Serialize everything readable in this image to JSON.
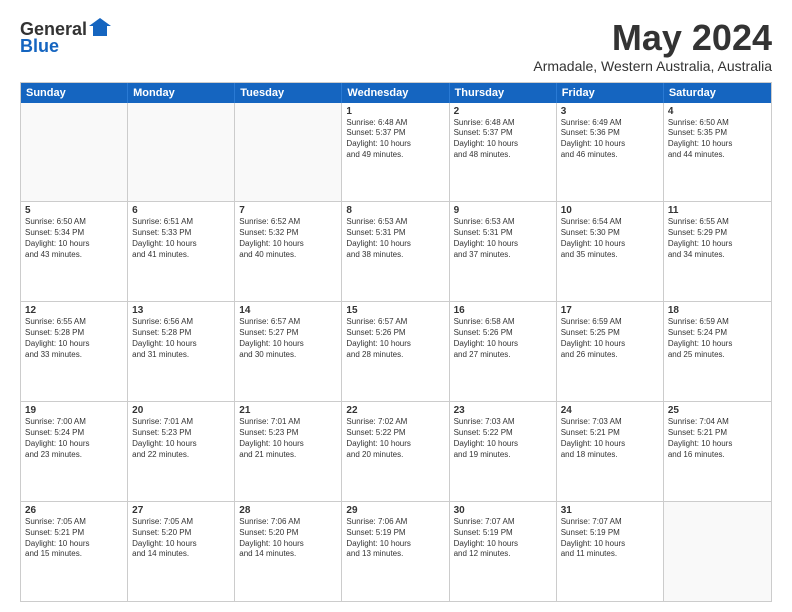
{
  "logo": {
    "general": "General",
    "blue": "Blue"
  },
  "title": "May 2024",
  "location": "Armadale, Western Australia, Australia",
  "headers": [
    "Sunday",
    "Monday",
    "Tuesday",
    "Wednesday",
    "Thursday",
    "Friday",
    "Saturday"
  ],
  "rows": [
    [
      {
        "day": "",
        "empty": true
      },
      {
        "day": "",
        "empty": true
      },
      {
        "day": "",
        "empty": true
      },
      {
        "day": "1",
        "line1": "Sunrise: 6:48 AM",
        "line2": "Sunset: 5:37 PM",
        "line3": "Daylight: 10 hours",
        "line4": "and 49 minutes."
      },
      {
        "day": "2",
        "line1": "Sunrise: 6:48 AM",
        "line2": "Sunset: 5:37 PM",
        "line3": "Daylight: 10 hours",
        "line4": "and 48 minutes."
      },
      {
        "day": "3",
        "line1": "Sunrise: 6:49 AM",
        "line2": "Sunset: 5:36 PM",
        "line3": "Daylight: 10 hours",
        "line4": "and 46 minutes."
      },
      {
        "day": "4",
        "line1": "Sunrise: 6:50 AM",
        "line2": "Sunset: 5:35 PM",
        "line3": "Daylight: 10 hours",
        "line4": "and 44 minutes."
      }
    ],
    [
      {
        "day": "5",
        "line1": "Sunrise: 6:50 AM",
        "line2": "Sunset: 5:34 PM",
        "line3": "Daylight: 10 hours",
        "line4": "and 43 minutes."
      },
      {
        "day": "6",
        "line1": "Sunrise: 6:51 AM",
        "line2": "Sunset: 5:33 PM",
        "line3": "Daylight: 10 hours",
        "line4": "and 41 minutes."
      },
      {
        "day": "7",
        "line1": "Sunrise: 6:52 AM",
        "line2": "Sunset: 5:32 PM",
        "line3": "Daylight: 10 hours",
        "line4": "and 40 minutes."
      },
      {
        "day": "8",
        "line1": "Sunrise: 6:53 AM",
        "line2": "Sunset: 5:31 PM",
        "line3": "Daylight: 10 hours",
        "line4": "and 38 minutes."
      },
      {
        "day": "9",
        "line1": "Sunrise: 6:53 AM",
        "line2": "Sunset: 5:31 PM",
        "line3": "Daylight: 10 hours",
        "line4": "and 37 minutes."
      },
      {
        "day": "10",
        "line1": "Sunrise: 6:54 AM",
        "line2": "Sunset: 5:30 PM",
        "line3": "Daylight: 10 hours",
        "line4": "and 35 minutes."
      },
      {
        "day": "11",
        "line1": "Sunrise: 6:55 AM",
        "line2": "Sunset: 5:29 PM",
        "line3": "Daylight: 10 hours",
        "line4": "and 34 minutes."
      }
    ],
    [
      {
        "day": "12",
        "line1": "Sunrise: 6:55 AM",
        "line2": "Sunset: 5:28 PM",
        "line3": "Daylight: 10 hours",
        "line4": "and 33 minutes."
      },
      {
        "day": "13",
        "line1": "Sunrise: 6:56 AM",
        "line2": "Sunset: 5:28 PM",
        "line3": "Daylight: 10 hours",
        "line4": "and 31 minutes."
      },
      {
        "day": "14",
        "line1": "Sunrise: 6:57 AM",
        "line2": "Sunset: 5:27 PM",
        "line3": "Daylight: 10 hours",
        "line4": "and 30 minutes."
      },
      {
        "day": "15",
        "line1": "Sunrise: 6:57 AM",
        "line2": "Sunset: 5:26 PM",
        "line3": "Daylight: 10 hours",
        "line4": "and 28 minutes."
      },
      {
        "day": "16",
        "line1": "Sunrise: 6:58 AM",
        "line2": "Sunset: 5:26 PM",
        "line3": "Daylight: 10 hours",
        "line4": "and 27 minutes."
      },
      {
        "day": "17",
        "line1": "Sunrise: 6:59 AM",
        "line2": "Sunset: 5:25 PM",
        "line3": "Daylight: 10 hours",
        "line4": "and 26 minutes."
      },
      {
        "day": "18",
        "line1": "Sunrise: 6:59 AM",
        "line2": "Sunset: 5:24 PM",
        "line3": "Daylight: 10 hours",
        "line4": "and 25 minutes."
      }
    ],
    [
      {
        "day": "19",
        "line1": "Sunrise: 7:00 AM",
        "line2": "Sunset: 5:24 PM",
        "line3": "Daylight: 10 hours",
        "line4": "and 23 minutes."
      },
      {
        "day": "20",
        "line1": "Sunrise: 7:01 AM",
        "line2": "Sunset: 5:23 PM",
        "line3": "Daylight: 10 hours",
        "line4": "and 22 minutes."
      },
      {
        "day": "21",
        "line1": "Sunrise: 7:01 AM",
        "line2": "Sunset: 5:23 PM",
        "line3": "Daylight: 10 hours",
        "line4": "and 21 minutes."
      },
      {
        "day": "22",
        "line1": "Sunrise: 7:02 AM",
        "line2": "Sunset: 5:22 PM",
        "line3": "Daylight: 10 hours",
        "line4": "and 20 minutes."
      },
      {
        "day": "23",
        "line1": "Sunrise: 7:03 AM",
        "line2": "Sunset: 5:22 PM",
        "line3": "Daylight: 10 hours",
        "line4": "and 19 minutes."
      },
      {
        "day": "24",
        "line1": "Sunrise: 7:03 AM",
        "line2": "Sunset: 5:21 PM",
        "line3": "Daylight: 10 hours",
        "line4": "and 18 minutes."
      },
      {
        "day": "25",
        "line1": "Sunrise: 7:04 AM",
        "line2": "Sunset: 5:21 PM",
        "line3": "Daylight: 10 hours",
        "line4": "and 16 minutes."
      }
    ],
    [
      {
        "day": "26",
        "line1": "Sunrise: 7:05 AM",
        "line2": "Sunset: 5:21 PM",
        "line3": "Daylight: 10 hours",
        "line4": "and 15 minutes."
      },
      {
        "day": "27",
        "line1": "Sunrise: 7:05 AM",
        "line2": "Sunset: 5:20 PM",
        "line3": "Daylight: 10 hours",
        "line4": "and 14 minutes."
      },
      {
        "day": "28",
        "line1": "Sunrise: 7:06 AM",
        "line2": "Sunset: 5:20 PM",
        "line3": "Daylight: 10 hours",
        "line4": "and 14 minutes."
      },
      {
        "day": "29",
        "line1": "Sunrise: 7:06 AM",
        "line2": "Sunset: 5:19 PM",
        "line3": "Daylight: 10 hours",
        "line4": "and 13 minutes."
      },
      {
        "day": "30",
        "line1": "Sunrise: 7:07 AM",
        "line2": "Sunset: 5:19 PM",
        "line3": "Daylight: 10 hours",
        "line4": "and 12 minutes."
      },
      {
        "day": "31",
        "line1": "Sunrise: 7:07 AM",
        "line2": "Sunset: 5:19 PM",
        "line3": "Daylight: 10 hours",
        "line4": "and 11 minutes."
      },
      {
        "day": "",
        "empty": true
      }
    ]
  ]
}
